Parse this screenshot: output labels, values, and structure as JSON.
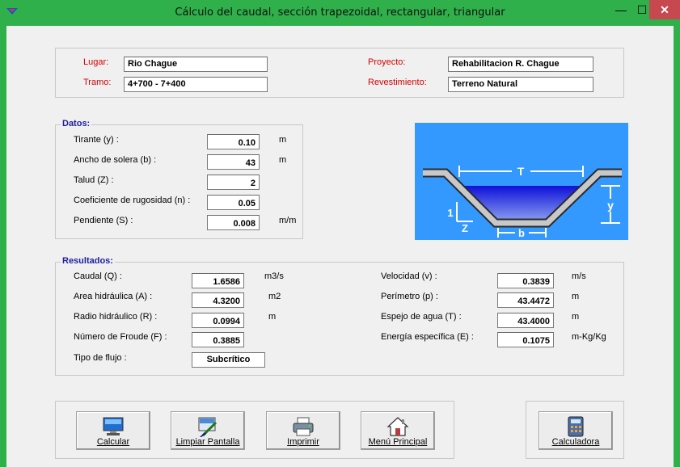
{
  "window": {
    "title": "Cálculo del caudal, sección trapezoidal, rectangular, triangular",
    "minimize_glyph": "—",
    "maximize_glyph": "☐",
    "close_glyph": "✕"
  },
  "header": {
    "lugar_label": "Lugar:",
    "lugar_value": "Rio Chague",
    "tramo_label": "Tramo:",
    "tramo_value": "4+700 - 7+400",
    "proyecto_label": "Proyecto:",
    "proyecto_value": "Rehabilitacion R. Chague",
    "revestimiento_label": "Revestimiento:",
    "revestimiento_value": "Terreno Natural"
  },
  "datos": {
    "title": "Datos:",
    "tirante_label": "Tirante (y) :",
    "tirante_value": "0.10",
    "tirante_unit": "m",
    "solera_label": "Ancho de solera (b) :",
    "solera_value": "43",
    "solera_unit": "m",
    "talud_label": "Talud  (Z) :",
    "talud_value": "2",
    "rugosidad_label": "Coeficiente de rugosidad (n) :",
    "rugosidad_value": "0.05",
    "pendiente_label": "Pendiente (S) :",
    "pendiente_value": "0.008",
    "pendiente_unit": "m/m"
  },
  "diagram": {
    "T": "T",
    "y": "y",
    "one": "1",
    "Z": "Z",
    "b": "b"
  },
  "resultados": {
    "title": "Resultados:",
    "caudal_label": "Caudal (Q) :",
    "caudal_value": "1.6586",
    "caudal_unit": "m3/s",
    "area_label": "Area hidráulica (A) :",
    "area_value": "4.3200",
    "area_unit": "m2",
    "radio_label": "Radio hidráulico (R) :",
    "radio_value": "0.0994",
    "radio_unit": "m",
    "froude_label": "Número de Froude (F) :",
    "froude_value": "0.3885",
    "flujo_label": "Tipo de flujo :",
    "flujo_value": "Subcrítico",
    "velocidad_label": "Velocidad (v) :",
    "velocidad_value": "0.3839",
    "velocidad_unit": "m/s",
    "perimetro_label": "Perímetro (p) :",
    "perimetro_value": "43.4472",
    "perimetro_unit": "m",
    "espejo_label": "Espejo de agua (T) :",
    "espejo_value": "43.4000",
    "espejo_unit": "m",
    "energia_label": "Energía específica (E) :",
    "energia_value": "0.1075",
    "energia_unit": "m-Kg/Kg"
  },
  "buttons": {
    "calcular": "Calcular",
    "limpiar": "Limpiar Pantalla",
    "imprimir": "Imprimir",
    "menu": "Menú Principal",
    "calculadora": "Calculadora"
  },
  "colors": {
    "titlebar": "#2fb04a",
    "close": "#c7484e",
    "diagram_bg": "#3399ff",
    "group_title": "#1d1d9e",
    "label_red": "#d40000"
  }
}
